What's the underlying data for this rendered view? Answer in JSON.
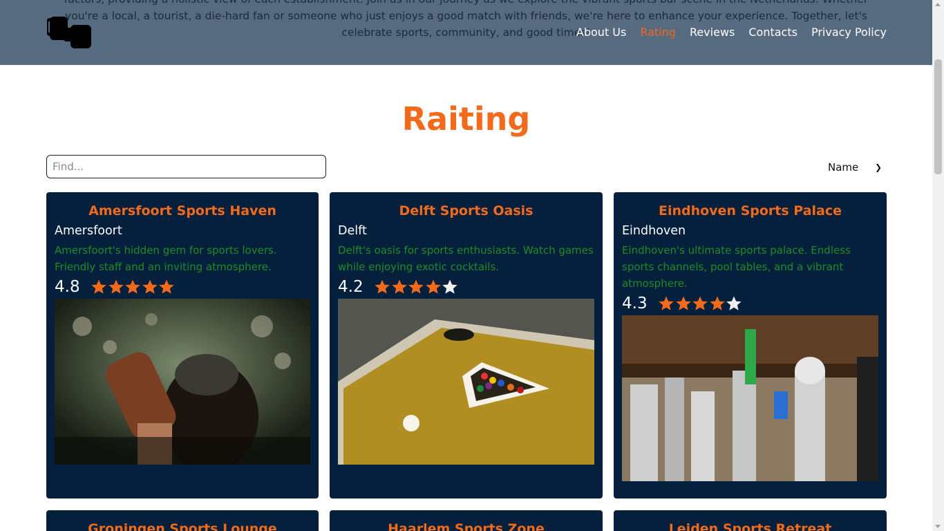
{
  "header": {
    "intro_text": "factors, providing a holistic view of each establishment. Join us in our journey as we explore the vibrant sports bar scene in the Netherlands. Whether you're a local, a tourist, a die-hard fan or someone who just enjoys a good match with friends, we're here to enhance your experience. Together, let's celebrate sports, community, and good times!",
    "nav": [
      {
        "label": "About Us",
        "active": false
      },
      {
        "label": "Rating",
        "active": true
      },
      {
        "label": "Reviews",
        "active": false
      },
      {
        "label": "Contacts",
        "active": false
      },
      {
        "label": "Privacy Policy",
        "active": false
      }
    ]
  },
  "main": {
    "title": "Raiting",
    "search_placeholder": "Find...",
    "sort_value": "Name"
  },
  "cards": [
    {
      "title": "Amersfoort Sports Haven",
      "city": "Amersfoort",
      "description": "Amersfoort's hidden gem for sports lovers. Friendly staff and an inviting atmosphere.",
      "rating": "4.8",
      "stars_filled": 5,
      "image": "bartender-photo"
    },
    {
      "title": "Delft Sports Oasis",
      "city": "Delft",
      "description": "Delft's oasis for sports enthusiasts. Watch games while enjoying exotic cocktails.",
      "rating": "4.2",
      "stars_filled": 4,
      "image": "pool-table-photo"
    },
    {
      "title": "Eindhoven Sports Palace",
      "city": "Eindhoven",
      "description": "Eindhoven's ultimate sports palace. Endless sports channels, pool tables, and a vibrant atmosphere.",
      "rating": "4.3",
      "stars_filled": 4,
      "image": "beer-taps-photo"
    },
    {
      "title": "Groningen Sports Lounge"
    },
    {
      "title": "Haarlem Sports Zone"
    },
    {
      "title": "Leiden Sports Retreat"
    }
  ],
  "colors": {
    "accent": "#f26a1b",
    "card_bg": "#04203d",
    "header_bg": "#566a80",
    "description": "#228b22",
    "star_filled": "#f26a1b",
    "star_empty": "#f0f0f0"
  }
}
